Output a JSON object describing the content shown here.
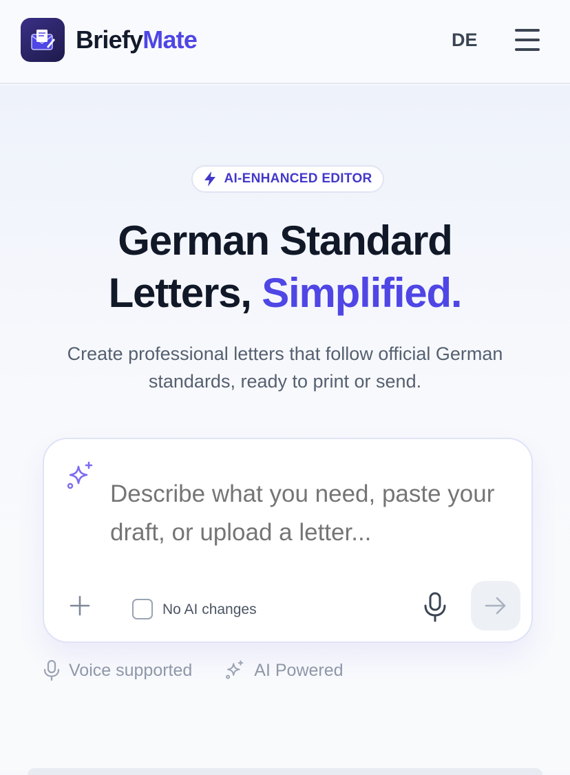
{
  "header": {
    "brand_part1": "Briefy",
    "brand_part2": "Mate",
    "language": "DE",
    "menu_icon": "hamburger-menu-icon"
  },
  "hero": {
    "badge": "AI-ENHANCED EDITOR",
    "title_line1": "German Standard",
    "title_line2_plain": "Letters, ",
    "title_line2_accent": "Simplified.",
    "subtitle": "Create professional letters that follow official German standards, ready to print or send."
  },
  "composer": {
    "placeholder": "Describe what you need, paste your draft, or upload a letter...",
    "checkbox_label": "No AI changes",
    "checkbox_checked": false
  },
  "features": [
    {
      "icon": "microphone-icon",
      "label": "Voice supported"
    },
    {
      "icon": "sparkles-icon",
      "label": "AI Powered"
    }
  ],
  "colors": {
    "accent": "#4f46e5",
    "text_dark": "#111827",
    "muted": "#8e98a8"
  }
}
